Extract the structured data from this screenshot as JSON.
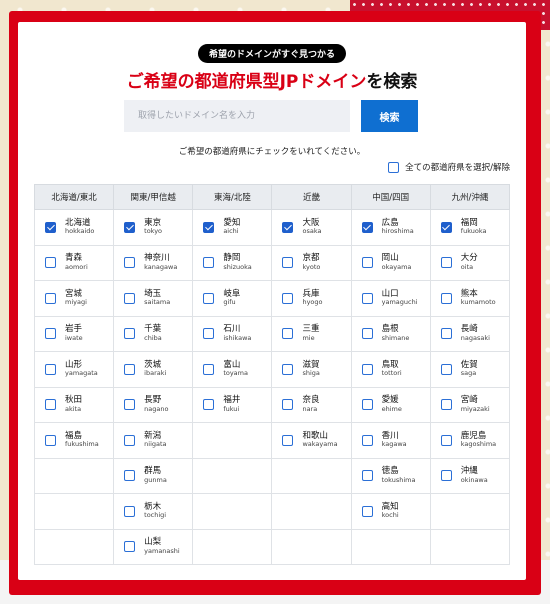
{
  "header": {
    "badge": "希望のドメインがすぐ見つかる",
    "title_red": "ご希望の都道府県型JPドメイン",
    "title_black": "を検索"
  },
  "search": {
    "placeholder": "取得したいドメイン名を入力",
    "button_label": "検索"
  },
  "instruction": "ご希望の都道府県にチェックをいれてください。",
  "select_all": {
    "label": "全ての都道府県を選択/解除",
    "checked": false
  },
  "regions": [
    {
      "label": "北海道/東北",
      "prefectures": [
        {
          "jp": "北海道",
          "en": "hokkaido",
          "checked": true
        },
        {
          "jp": "青森",
          "en": "aomori",
          "checked": false
        },
        {
          "jp": "宮城",
          "en": "miyagi",
          "checked": false
        },
        {
          "jp": "岩手",
          "en": "iwate",
          "checked": false
        },
        {
          "jp": "山形",
          "en": "yamagata",
          "checked": false
        },
        {
          "jp": "秋田",
          "en": "akita",
          "checked": false
        },
        {
          "jp": "福島",
          "en": "fukushima",
          "checked": false
        }
      ]
    },
    {
      "label": "関東/甲信越",
      "prefectures": [
        {
          "jp": "東京",
          "en": "tokyo",
          "checked": true
        },
        {
          "jp": "神奈川",
          "en": "kanagawa",
          "checked": false
        },
        {
          "jp": "埼玉",
          "en": "saitama",
          "checked": false
        },
        {
          "jp": "千葉",
          "en": "chiba",
          "checked": false
        },
        {
          "jp": "茨城",
          "en": "ibaraki",
          "checked": false
        },
        {
          "jp": "長野",
          "en": "nagano",
          "checked": false
        },
        {
          "jp": "新潟",
          "en": "niigata",
          "checked": false
        },
        {
          "jp": "群馬",
          "en": "gunma",
          "checked": false
        },
        {
          "jp": "栃木",
          "en": "tochigi",
          "checked": false
        },
        {
          "jp": "山梨",
          "en": "yamanashi",
          "checked": false
        }
      ]
    },
    {
      "label": "東海/北陸",
      "prefectures": [
        {
          "jp": "愛知",
          "en": "aichi",
          "checked": true
        },
        {
          "jp": "静岡",
          "en": "shizuoka",
          "checked": false
        },
        {
          "jp": "岐阜",
          "en": "gifu",
          "checked": false
        },
        {
          "jp": "石川",
          "en": "ishikawa",
          "checked": false
        },
        {
          "jp": "富山",
          "en": "toyama",
          "checked": false
        },
        {
          "jp": "福井",
          "en": "fukui",
          "checked": false
        }
      ]
    },
    {
      "label": "近畿",
      "prefectures": [
        {
          "jp": "大阪",
          "en": "osaka",
          "checked": true
        },
        {
          "jp": "京都",
          "en": "kyoto",
          "checked": false
        },
        {
          "jp": "兵庫",
          "en": "hyogo",
          "checked": false
        },
        {
          "jp": "三重",
          "en": "mie",
          "checked": false
        },
        {
          "jp": "滋賀",
          "en": "shiga",
          "checked": false
        },
        {
          "jp": "奈良",
          "en": "nara",
          "checked": false
        },
        {
          "jp": "和歌山",
          "en": "wakayama",
          "checked": false
        }
      ]
    },
    {
      "label": "中国/四国",
      "prefectures": [
        {
          "jp": "広島",
          "en": "hiroshima",
          "checked": true
        },
        {
          "jp": "岡山",
          "en": "okayama",
          "checked": false
        },
        {
          "jp": "山口",
          "en": "yamaguchi",
          "checked": false
        },
        {
          "jp": "島根",
          "en": "shimane",
          "checked": false
        },
        {
          "jp": "鳥取",
          "en": "tottori",
          "checked": false
        },
        {
          "jp": "愛媛",
          "en": "ehime",
          "checked": false
        },
        {
          "jp": "香川",
          "en": "kagawa",
          "checked": false
        },
        {
          "jp": "徳島",
          "en": "tokushima",
          "checked": false
        },
        {
          "jp": "高知",
          "en": "kochi",
          "checked": false
        }
      ]
    },
    {
      "label": "九州/沖縄",
      "prefectures": [
        {
          "jp": "福岡",
          "en": "fukuoka",
          "checked": true
        },
        {
          "jp": "大分",
          "en": "oita",
          "checked": false
        },
        {
          "jp": "熊本",
          "en": "kumamoto",
          "checked": false
        },
        {
          "jp": "長崎",
          "en": "nagasaki",
          "checked": false
        },
        {
          "jp": "佐賀",
          "en": "saga",
          "checked": false
        },
        {
          "jp": "宮崎",
          "en": "miyazaki",
          "checked": false
        },
        {
          "jp": "鹿児島",
          "en": "kagoshima",
          "checked": false
        },
        {
          "jp": "沖縄",
          "en": "okinawa",
          "checked": false
        }
      ]
    }
  ]
}
